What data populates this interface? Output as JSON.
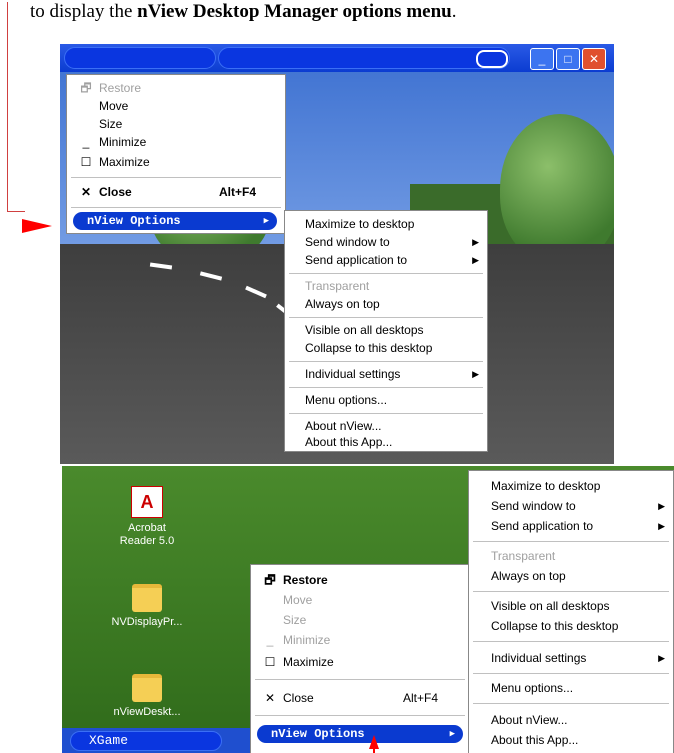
{
  "caption": {
    "prefix": "to display the ",
    "bold": "nView Desktop Manager options menu",
    "suffix": "."
  },
  "system_menu_top": {
    "items": [
      {
        "icon": "restore",
        "label": "Restore",
        "disabled": true
      },
      {
        "icon": "",
        "label": "Move",
        "disabled": false
      },
      {
        "icon": "",
        "label": "Size",
        "disabled": false
      },
      {
        "icon": "minimize",
        "label": "Minimize",
        "disabled": false
      },
      {
        "icon": "maximize",
        "label": "Maximize",
        "disabled": false
      },
      {
        "icon": "close",
        "label": "Close",
        "shortcut": "Alt+F4",
        "bold": true
      }
    ],
    "nview_options": "nView Options"
  },
  "nview_submenu": {
    "groups": [
      [
        {
          "label": "Maximize to desktop"
        },
        {
          "label": "Send window to",
          "submenu": true
        },
        {
          "label": "Send application to",
          "submenu": true
        }
      ],
      [
        {
          "label": "Transparent",
          "disabled": true
        },
        {
          "label": "Always on top"
        }
      ],
      [
        {
          "label": "Visible on all desktops"
        },
        {
          "label": "Collapse to this desktop"
        }
      ],
      [
        {
          "label": "Individual settings",
          "submenu": true
        }
      ],
      [
        {
          "label": "Menu options..."
        }
      ],
      [
        {
          "label": "About nView..."
        },
        {
          "label": "About this App..."
        }
      ]
    ]
  },
  "system_menu_bottom": {
    "items": [
      {
        "icon": "restore",
        "label": "Restore",
        "disabled": false,
        "bold": true
      },
      {
        "icon": "",
        "label": "Move",
        "disabled": true
      },
      {
        "icon": "",
        "label": "Size",
        "disabled": true
      },
      {
        "icon": "minimize",
        "label": "Minimize",
        "disabled": true
      },
      {
        "icon": "maximize",
        "label": "Maximize",
        "disabled": false
      },
      {
        "icon": "close",
        "label": "Close",
        "shortcut": "Alt+F4"
      }
    ],
    "nview_options": "nView Options"
  },
  "desktop_icons": [
    {
      "label_line1": "Acrobat",
      "label_line2": "Reader 5.0"
    },
    {
      "label_line1": "NVDisplayPr...",
      "label_line2": ""
    },
    {
      "label_line1": "nViewDeskt...",
      "label_line2": ""
    }
  ],
  "taskbar": {
    "item": "XGame"
  }
}
